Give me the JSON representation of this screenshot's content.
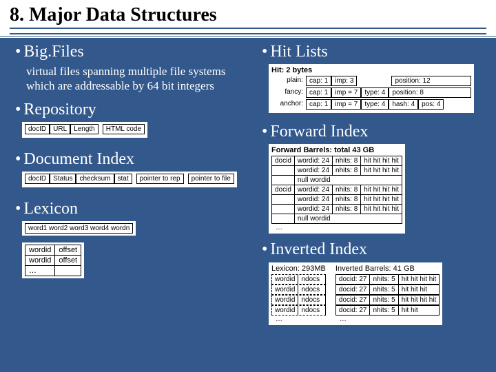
{
  "title": "8. Major Data Structures",
  "left": {
    "bigfiles": {
      "label": "Big.Files",
      "desc": "virtual files spanning multiple file systems which are addressable by 64 bit integers"
    },
    "repository": {
      "label": "Repository",
      "cells": [
        "docID",
        "URL",
        "Length",
        "HTML code"
      ]
    },
    "docindex": {
      "label": "Document Index",
      "cells": [
        "docID",
        "Status",
        "checksum",
        "stat",
        "pointer to rep",
        "pointer to file"
      ]
    },
    "lexicon": {
      "label": "Lexicon",
      "words": "word1  word2  word3  word4   wordn",
      "table": [
        [
          "wordid",
          "offset"
        ],
        [
          "wordid",
          "offset"
        ],
        [
          "…",
          ""
        ]
      ]
    }
  },
  "right": {
    "hitlists": {
      "label": "Hit Lists",
      "header": "Hit: 2 bytes",
      "rows": {
        "plain": {
          "lbl": "plain:",
          "cells": [
            "cap: 1",
            "imp: 3",
            "",
            "position: 12"
          ]
        },
        "fancy": {
          "lbl": "fancy:",
          "cells": [
            "cap: 1",
            "imp = 7",
            "type: 4",
            "position: 8"
          ]
        },
        "anchor": {
          "lbl": "anchor:",
          "cells": [
            "cap: 1",
            "imp = 7",
            "type: 4",
            "hash: 4",
            "pos: 4"
          ]
        }
      }
    },
    "forward": {
      "label": "Forward Index",
      "header": "Forward Barrels: total 43 GB",
      "rows": [
        [
          "docid",
          "wordid: 24",
          "nhits: 8",
          "hit hit hit hit"
        ],
        [
          "",
          "wordid: 24",
          "nhits: 8",
          "hit hit hit hit"
        ],
        [
          "",
          "null wordid",
          "",
          ""
        ],
        [
          "docid",
          "wordid: 24",
          "nhits: 8",
          "hit hit hit hit"
        ],
        [
          "",
          "wordid: 24",
          "nhits: 8",
          "hit hit hit hit"
        ],
        [
          "",
          "wordid: 24",
          "nhits: 8",
          "hit hit hit hit"
        ],
        [
          "",
          "null wordid",
          "",
          ""
        ]
      ],
      "ell": "…"
    },
    "inverted": {
      "label": "Inverted Index",
      "lexicon": {
        "header": "Lexicon: 293MB",
        "rows": [
          "wordid | ndocs",
          "wordid | ndocs",
          "wordid | ndocs",
          "wordid | ndocs"
        ],
        "ell": "…"
      },
      "barrels": {
        "header": "Inverted Barrels: 41 GB",
        "rows": [
          [
            "docid: 27",
            "nhits: 5",
            "hit hit hit hit"
          ],
          [
            "docid: 27",
            "nhits: 5",
            "hit hit hit"
          ],
          [
            "docid: 27",
            "nhits: 5",
            "hit hit hit hit"
          ],
          [
            "docid: 27",
            "nhits: 5",
            "hit hit"
          ]
        ],
        "ell": "…"
      }
    }
  }
}
